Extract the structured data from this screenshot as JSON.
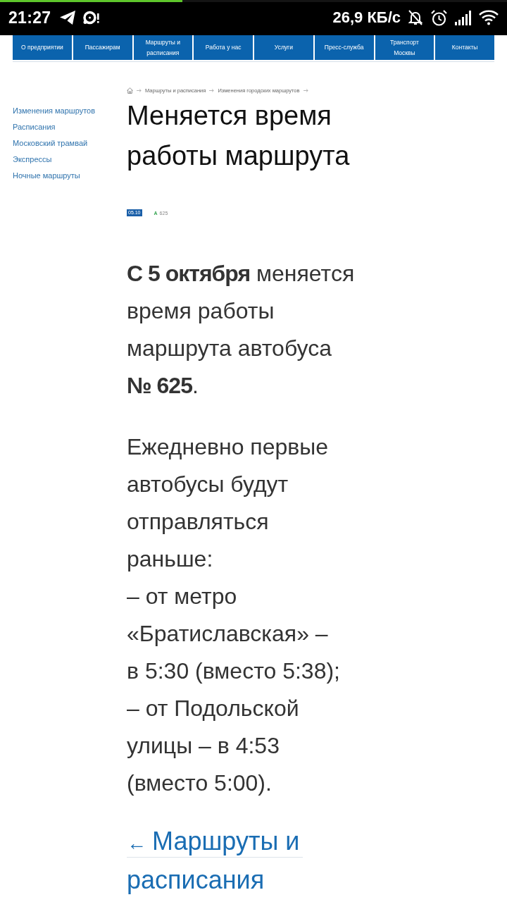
{
  "status_bar": {
    "time": "21:27",
    "network_speed": "26,9 КБ/с"
  },
  "loading_bar": {
    "level": 0.36
  },
  "nav": {
    "items": [
      {
        "label": "О предприятии"
      },
      {
        "label": "Пассажирам"
      },
      {
        "label": "Маршруты и расписания"
      },
      {
        "label": "Работа у нас"
      },
      {
        "label": "Услуги"
      },
      {
        "label": "Пресс-служба"
      },
      {
        "label": "Транспорт Москвы"
      },
      {
        "label": "Контакты"
      }
    ]
  },
  "sidebar": {
    "items": [
      {
        "label": "Изменения маршрутов"
      },
      {
        "label": "Расписания"
      },
      {
        "label": "Московский трамвай"
      },
      {
        "label": "Экспрессы"
      },
      {
        "label": "Ночные маршруты"
      }
    ]
  },
  "breadcrumb": {
    "items": [
      {
        "label": "Маршруты и расписания"
      },
      {
        "label": "Изменения городских маршрутов"
      }
    ]
  },
  "article": {
    "title": "Меняется время работы маршрута",
    "date": "05.10",
    "route": {
      "type_letter": "А",
      "number": "625"
    },
    "paragraphs": [
      "**С 5 октября** меняется время работы маршрута автобуса **№ 625**.",
      "Ежедневно первые автобусы будут отправляться раньше:\n– от метро «Братиславская» – в 5:30 (вместо 5:38);\n– от Подольской улицы – в 4:53 (вместо 5:00)."
    ],
    "back_link": {
      "arrow": "←",
      "label": "Маршруты и расписания"
    }
  }
}
